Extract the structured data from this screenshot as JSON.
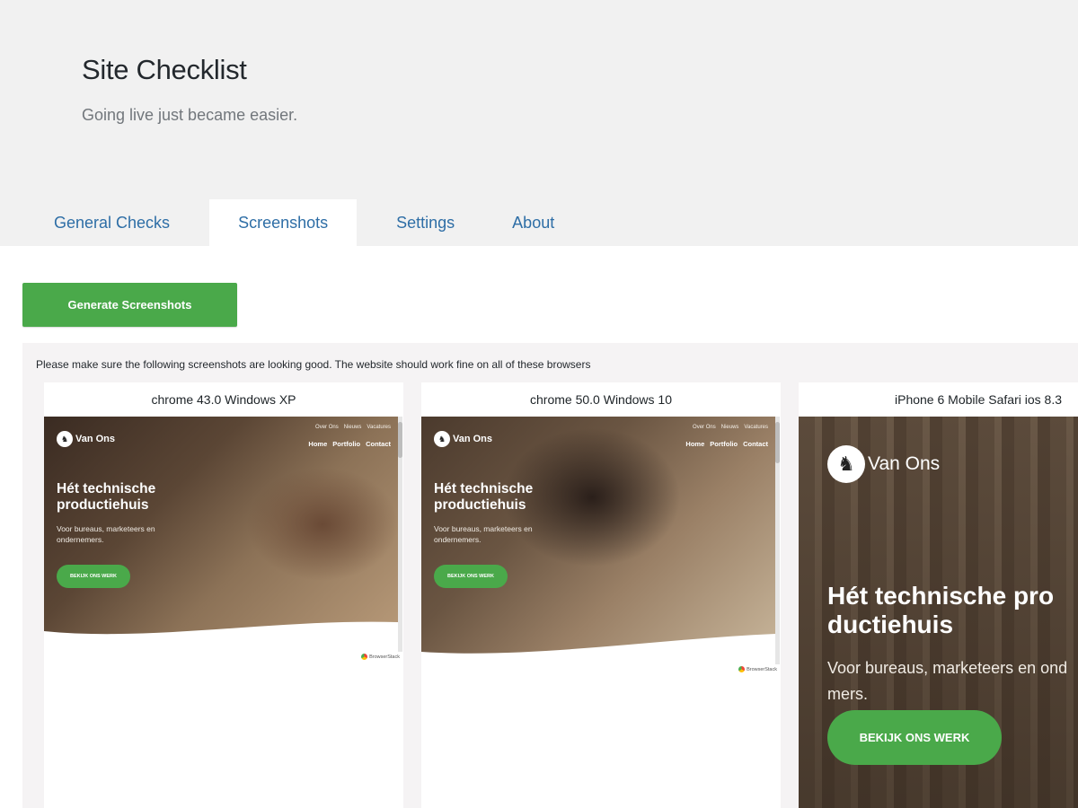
{
  "header": {
    "title": "Site Checklist",
    "subtitle": "Going live just became easier."
  },
  "tabs": [
    {
      "label": "General Checks",
      "active": false
    },
    {
      "label": "Screenshots",
      "active": true
    },
    {
      "label": "Settings",
      "active": false
    },
    {
      "label": "About",
      "active": false
    }
  ],
  "generate_button": "Generate Screenshots",
  "notice": "Please make sure the following screenshots are looking good. The website should work fine on all of these browsers",
  "screenshots": [
    {
      "browser": "chrome 43.0 Windows XP",
      "site": {
        "logo": "Van Ons",
        "nav_small": [
          "Over Ons",
          "Nieuws",
          "Vacatures"
        ],
        "nav_main": [
          "Home",
          "Portfolio",
          "Contact"
        ],
        "heading": "Hét technische productiehuis",
        "text": "Voor bureaus, marketeers en ondernemers.",
        "cta": "BEKIJK ONS WERK",
        "watermark": "BrowserStack"
      }
    },
    {
      "browser": "chrome 50.0 Windows 10",
      "site": {
        "logo": "Van Ons",
        "nav_small": [
          "Over Ons",
          "Nieuws",
          "Vacatures"
        ],
        "nav_main": [
          "Home",
          "Portfolio",
          "Contact"
        ],
        "heading": "Hét technische productiehuis",
        "text": "Voor bureaus, marketeers en ondernemers.",
        "cta": "BEKIJK ONS WERK",
        "watermark": "BrowserStack"
      }
    },
    {
      "browser": "iPhone 6 Mobile Safari ios 8.3",
      "site": {
        "logo": "Van Ons",
        "heading_line1": "Hét technische pro",
        "heading_line2": "ductiehuis",
        "text_line1": "Voor bureaus, marketeers en ond",
        "text_line2": "mers.",
        "cta": "BEKIJK ONS WERK"
      }
    }
  ],
  "colors": {
    "header_bg": "#f1f1f1",
    "tab_link": "#2e6ea6",
    "button_green": "#4aa94a",
    "panel_bg": "#f5f3f4"
  }
}
